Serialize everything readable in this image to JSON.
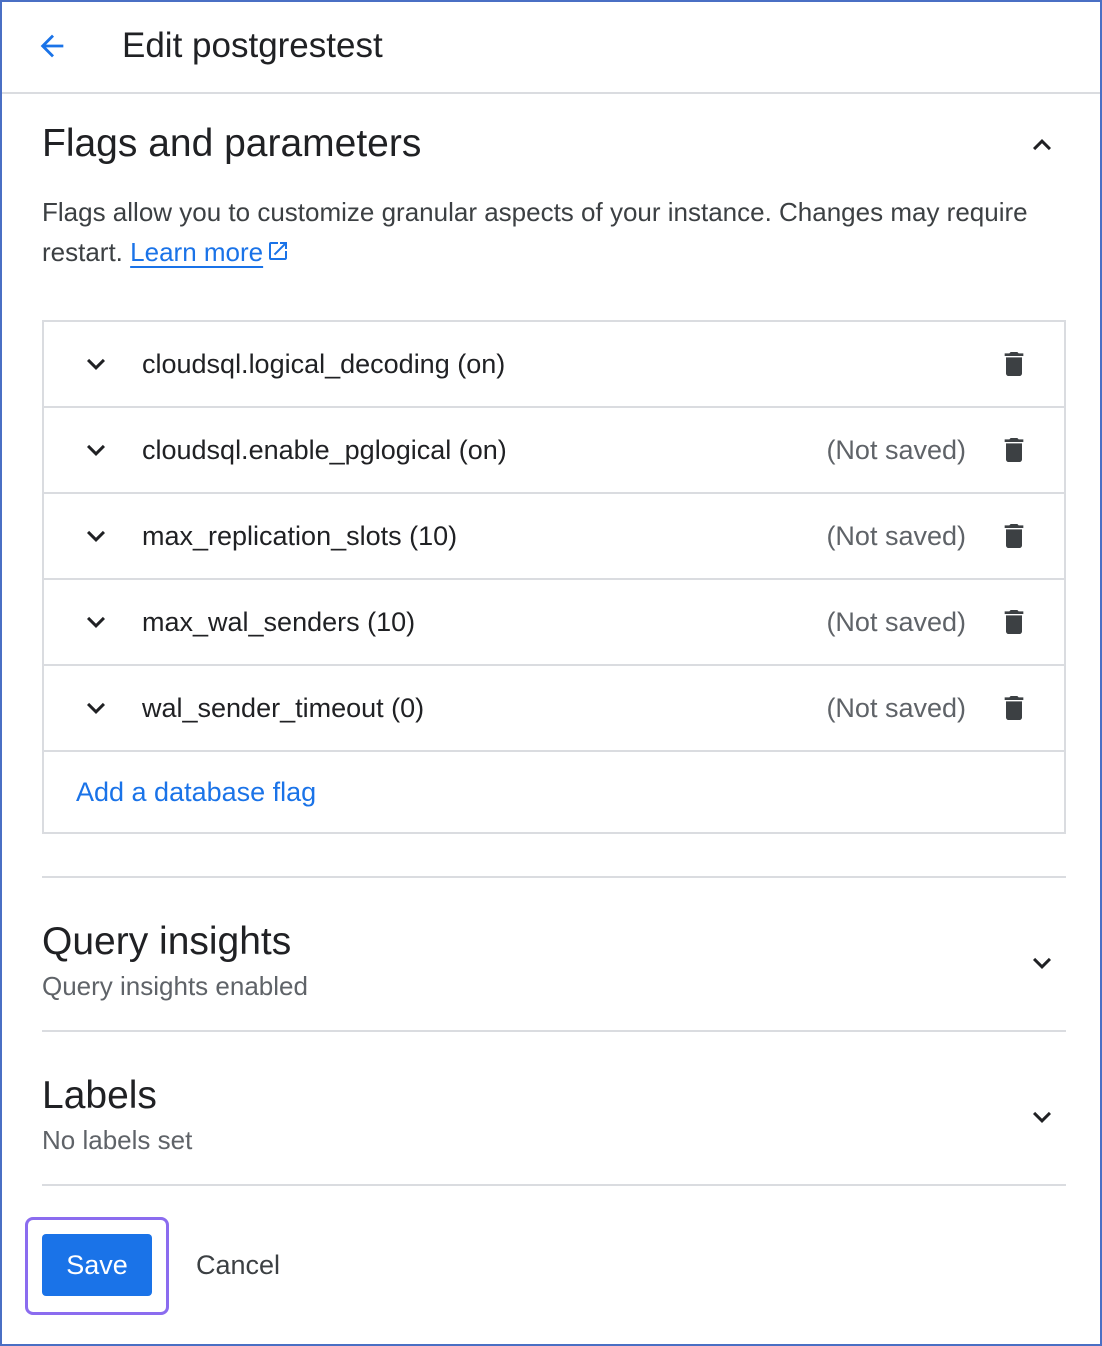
{
  "header": {
    "back_icon": "arrow-back-icon",
    "title": "Edit postgrestest"
  },
  "flags_section": {
    "title": "Flags and parameters",
    "toggle_icon": "chevron-up-icon",
    "description": "Flags allow you to customize granular aspects of your instance. Changes may require restart.",
    "learn_more": "Learn more",
    "learn_more_icon": "external-link-icon",
    "flags": [
      {
        "name": "cloudsql.logical_decoding (on)",
        "status": ""
      },
      {
        "name": "cloudsql.enable_pglogical (on)",
        "status": "(Not saved)"
      },
      {
        "name": "max_replication_slots (10)",
        "status": "(Not saved)"
      },
      {
        "name": "max_wal_senders (10)",
        "status": "(Not saved)"
      },
      {
        "name": "wal_sender_timeout (0)",
        "status": "(Not saved)"
      }
    ],
    "row_icons": [
      "chevron-down-icon",
      "delete-icon"
    ],
    "add_flag": "Add a database flag"
  },
  "query_insights": {
    "title": "Query insights",
    "subtitle": "Query insights enabled",
    "toggle_icon": "chevron-down-icon"
  },
  "labels": {
    "title": "Labels",
    "subtitle": "No labels set",
    "toggle_icon": "chevron-down-icon"
  },
  "actions": {
    "save": "Save",
    "cancel": "Cancel"
  },
  "colors": {
    "accent": "#1a73e8",
    "focus_ring": "#8b6cef",
    "divider": "#dadce0",
    "frame": "#4a6fc4"
  }
}
